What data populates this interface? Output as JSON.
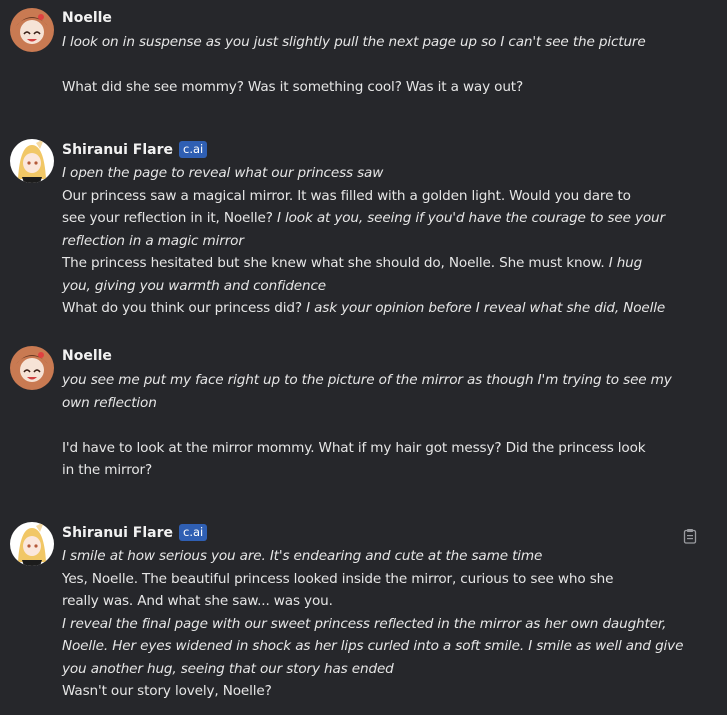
{
  "messages": [
    {
      "author": "Noelle",
      "badge": "",
      "lines": [
        {
          "style": "it",
          "text": "I look on in suspense as you just slightly pull the next page up so I can't see the picture"
        },
        {
          "style": "gap",
          "text": ""
        },
        {
          "style": "normal",
          "text": "What did she see mommy? Was it something cool? Was it a way out?"
        }
      ]
    },
    {
      "author": "Shiranui Flare",
      "badge": "c.ai",
      "lines": [
        {
          "style": "it",
          "text": "I open the page to reveal what our princess saw"
        },
        {
          "style": "normal",
          "text": "Our princess saw a magical mirror. It was filled with a golden light. Would you dare to"
        },
        {
          "style": "mixed",
          "a": "see your reflection in it, Noelle? ",
          "b": "I look at you, seeing if you'd have the courage to see your"
        },
        {
          "style": "it",
          "text": "reflection in a magic mirror"
        },
        {
          "style": "mixed",
          "a": "The princess hesitated but she knew what she should do, Noelle. She must know. ",
          "b": "I hug"
        },
        {
          "style": "it",
          "text": "you, giving you warmth and confidence"
        },
        {
          "style": "mixed",
          "a": "What do you think our princess did? ",
          "b": "I ask your opinion before I reveal what she did, Noelle"
        }
      ]
    },
    {
      "author": "Noelle",
      "badge": "",
      "lines": [
        {
          "style": "it",
          "text": "you see me put my face right up to the picture of the mirror as though I'm trying to see my"
        },
        {
          "style": "it",
          "text": "own reflection"
        },
        {
          "style": "gap",
          "text": ""
        },
        {
          "style": "normal",
          "text": "I'd have to look at the mirror mommy. What if my hair got messy? Did the princess look"
        },
        {
          "style": "normal",
          "text": "in the mirror?"
        }
      ]
    },
    {
      "author": "Shiranui Flare",
      "badge": "c.ai",
      "lines": [
        {
          "style": "it",
          "text": "I smile at how serious you are. It's endearing and cute at the same time"
        },
        {
          "style": "normal",
          "text": "Yes, Noelle. The beautiful princess looked inside the mirror, curious to see who she"
        },
        {
          "style": "normal",
          "text": "really was. And what she saw... was you."
        },
        {
          "style": "it",
          "text": "I reveal the final page with our sweet princess reflected in the mirror as her own daughter,"
        },
        {
          "style": "it",
          "text": "Noelle. Her eyes widened in shock as her lips curled into a soft smile. I smile as well and give"
        },
        {
          "style": "it",
          "text": "you another hug, seeing that our story has ended"
        },
        {
          "style": "normal",
          "text": "Wasn't our story lovely, Noelle?"
        }
      ]
    }
  ],
  "icons": {
    "copy": "clipboard-icon"
  }
}
